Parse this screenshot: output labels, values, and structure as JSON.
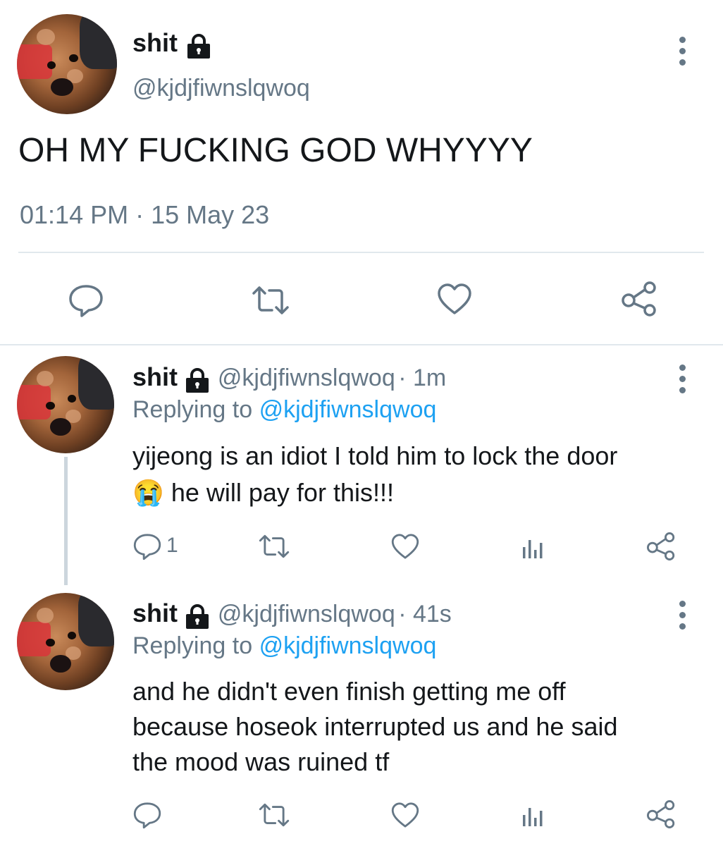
{
  "main_tweet": {
    "display_name": "shit",
    "handle": "@kjdjfiwnslqwoq",
    "text": "OH MY FUCKING GOD WHYYYY",
    "timestamp": "01:14 PM · 15 May 23",
    "actions": [
      "reply-icon",
      "retweet-icon",
      "like-icon",
      "share-icon"
    ]
  },
  "replies": [
    {
      "display_name": "shit",
      "handle": "@kjdjfiwnslqwoq",
      "time": "· 1m",
      "replying_label": "Replying to",
      "replying_handle": "@kjdjfiwnslqwoq",
      "text_line1": "yijeong is an idiot I told him to lock the door",
      "emoji": "😭",
      "text_line2": "he will pay for this!!!",
      "reply_count": "1"
    },
    {
      "display_name": "shit",
      "handle": "@kjdjfiwnslqwoq",
      "time": "· 41s",
      "replying_label": "Replying to",
      "replying_handle": "@kjdjfiwnslqwoq",
      "text_line1": "and he didn't even finish getting me off",
      "text_line2": "because hoseok interrupted us and he said",
      "text_line3": "the mood was ruined tf",
      "reply_count": ""
    }
  ],
  "colors": {
    "text": "#14171a",
    "secondary": "#657786",
    "link": "#1da1f2",
    "divider": "#e1e8ed"
  }
}
